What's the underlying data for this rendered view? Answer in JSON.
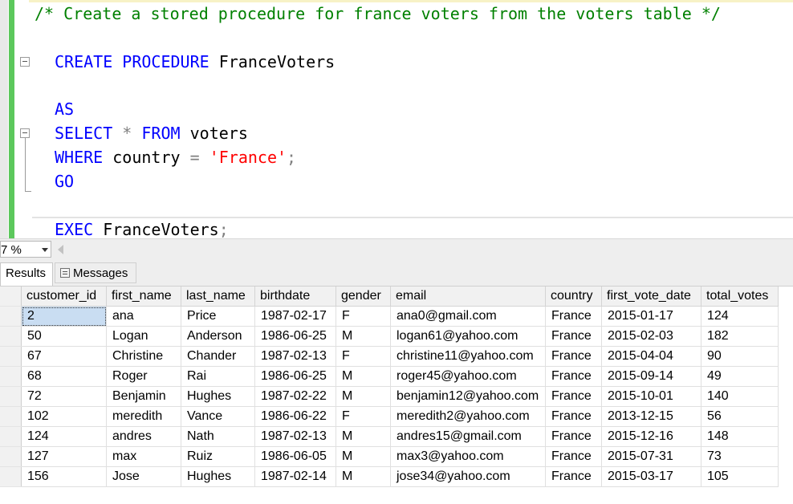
{
  "editor": {
    "comment": "/* Create a stored procedure for france voters from the voters table */",
    "create_kw": "CREATE PROCEDURE",
    "proc_name": "FranceVoters",
    "as_kw": "AS",
    "select_kw": "SELECT",
    "star": "*",
    "from_kw": "FROM",
    "table_name": "voters",
    "where_kw": "WHERE",
    "column": "country",
    "equals": "=",
    "value": "'France'",
    "semicolon": ";",
    "go_kw": "GO",
    "exec_kw": "EXEC",
    "exec_target": "FranceVoters",
    "exec_semicolon": ";"
  },
  "zoom": {
    "value": "7 %"
  },
  "tabs": {
    "results": "Results",
    "messages": "Messages"
  },
  "grid": {
    "columns": [
      "customer_id",
      "first_name",
      "last_name",
      "birthdate",
      "gender",
      "email",
      "country",
      "first_vote_date",
      "total_votes"
    ],
    "rows": [
      [
        "2",
        "ana",
        "Price",
        "1987-02-17",
        "F",
        "ana0@gmail.com",
        "France",
        "2015-01-17",
        "124"
      ],
      [
        "50",
        "Logan",
        "Anderson",
        "1986-06-25",
        "M",
        "logan61@yahoo.com",
        "France",
        "2015-02-03",
        "182"
      ],
      [
        "67",
        "Christine",
        "Chander",
        "1987-02-13",
        "F",
        "christine11@yahoo.com",
        "France",
        "2015-04-04",
        "90"
      ],
      [
        "68",
        "Roger",
        "Rai",
        "1986-06-25",
        "M",
        "roger45@yahoo.com",
        "France",
        "2015-09-14",
        "49"
      ],
      [
        "72",
        "Benjamin",
        "Hughes",
        "1987-02-22",
        "M",
        "benjamin12@yahoo.com",
        "France",
        "2015-10-01",
        "140"
      ],
      [
        "102",
        "meredith",
        "Vance",
        "1986-06-22",
        "F",
        "meredith2@yahoo.com",
        "France",
        "2013-12-15",
        "56"
      ],
      [
        "124",
        "andres",
        "Nath",
        "1987-02-13",
        "M",
        "andres15@gmail.com",
        "France",
        "2015-12-16",
        "148"
      ],
      [
        "127",
        "max",
        "Ruiz",
        "1986-06-05",
        "M",
        "max3@yahoo.com",
        "France",
        "2015-07-31",
        "73"
      ],
      [
        "156",
        "Jose",
        "Hughes",
        "1987-02-14",
        "M",
        "jose34@yahoo.com",
        "France",
        "2015-03-17",
        "105"
      ]
    ]
  }
}
